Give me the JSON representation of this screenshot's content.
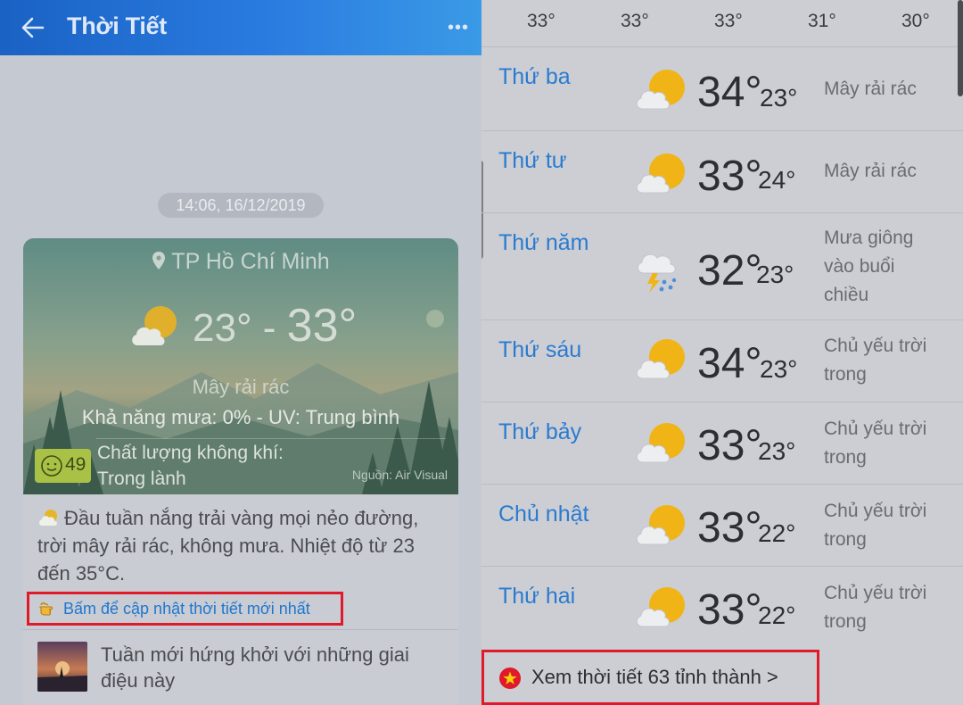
{
  "header": {
    "title": "Thời Tiết",
    "more": "•••"
  },
  "timestamp": "14:06, 16/12/2019",
  "card": {
    "location": "TP Hồ Chí Minh",
    "temp_low": "23°",
    "temp_sep": " - ",
    "temp_high": "33°",
    "condition": "Mây rải rác",
    "rain_uv": "Khả năng mưa: 0% - UV: Trung bình",
    "aqi_value": "49",
    "aqi_label": "Chất lượng không khí:",
    "aqi_status": "Trong lành",
    "aqi_source": "Nguồn: Air Visual",
    "description": "Đầu tuần nắng trải vàng mọi nẻo đường, trời mây rải rác, không mưa. Nhiệt độ từ 23 đến 35°C.",
    "update_link": "Bấm để cập nhật thời tiết mới nhất",
    "news_title": "Tuần mới hứng khởi với những giai điệu này"
  },
  "hourly_temps": [
    "33°",
    "33°",
    "33°",
    "31°",
    "30°"
  ],
  "forecast": [
    {
      "day": "Thứ ba",
      "high": "34°",
      "low": "23°",
      "condition": "Mây rải rác",
      "icon": "partly-cloudy-icon"
    },
    {
      "day": "Thứ tư",
      "high": "33°",
      "low": "24°",
      "condition": "Mây rải rác",
      "icon": "partly-cloudy-icon"
    },
    {
      "day": "Thứ năm",
      "high": "32°",
      "low": "23°",
      "condition": "Mưa giông vào buổi chiều",
      "icon": "thunderstorm-icon"
    },
    {
      "day": "Thứ sáu",
      "high": "34°",
      "low": "23°",
      "condition": "Chủ yếu trời trong",
      "icon": "partly-cloudy-icon"
    },
    {
      "day": "Thứ bảy",
      "high": "33°",
      "low": "23°",
      "condition": "Chủ yếu trời trong",
      "icon": "partly-cloudy-icon"
    },
    {
      "day": "Chủ nhật",
      "high": "33°",
      "low": "22°",
      "condition": "Chủ yếu trời trong",
      "icon": "partly-cloudy-icon"
    },
    {
      "day": "Thứ hai",
      "high": "33°",
      "low": "22°",
      "condition": "Chủ yếu trời trong",
      "icon": "partly-cloudy-icon"
    }
  ],
  "provinces_button": "Xem thời tiết 63 tỉnh thành >",
  "colors": {
    "accent_blue": "#2a7bd0",
    "highlight_red": "#e0192b",
    "sun_yellow": "#f0b416"
  }
}
